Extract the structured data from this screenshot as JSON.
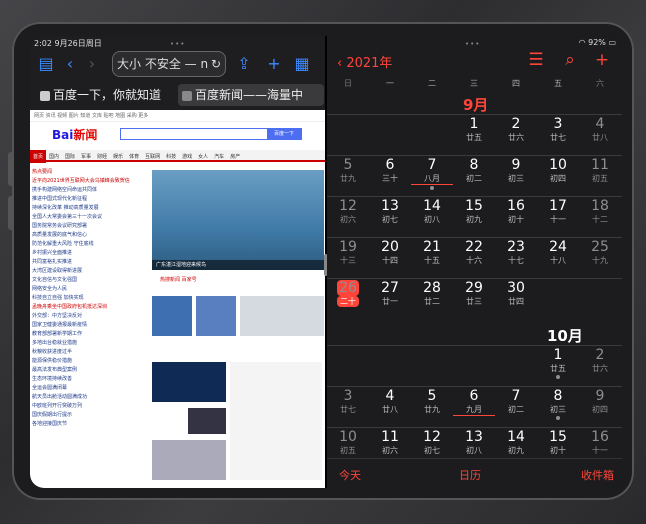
{
  "safari": {
    "status_time": "2:02  9月26日周日",
    "url_text": "大小  不安全 — n",
    "tabs": [
      {
        "label": "百度一下，你就知道"
      },
      {
        "label": "百度新闻——海量中"
      }
    ],
    "page": {
      "top_links": "网页 资讯 视频 图片 知道 文库 贴吧 地图 采购 更多",
      "logo_text": "Bai",
      "logo_suffix": "新闻",
      "search_button": "百度一下",
      "nav_items": [
        "首页",
        "国内",
        "国际",
        "军事",
        "财经",
        "娱乐",
        "体育",
        "互联网",
        "科技",
        "游戏",
        "女人",
        "汽车",
        "房产"
      ],
      "news": [
        "热点要闻",
        "近平向2021世界互联网大会乌镇峰会致贺信",
        "携手构建网络空间命运共同体",
        "推进中国式现代化新征程",
        "持续深化改革 推动高质量发展",
        "全国人大常委会第三十一次会议",
        "国务院常务会议研究部署",
        "高质量发展的底气和信心",
        "防范化解重大风险 守住底线",
        "乡村振兴全面推进",
        "共同富裕扎实推进",
        "大湾区建设取得新进展",
        "文化自信与文化强国",
        "网络安全为人民",
        "科技自立自强 加快实现",
        "孟晚舟乘坐中国政府包机抵达深圳",
        "外交部：中方坚决反对",
        "国家卫健委通报最新疫情",
        "教育部部署新学期工作",
        "多地出台稳就业措施",
        "秋粮收获进度过半",
        "能源保供稳价措施",
        "最高法发布典型案例",
        "生态环境持续改善",
        "全运会圆满闭幕",
        "航天员出舱活动圆满成功",
        "中欧班列开行突破万列",
        "国庆假期出行提示",
        "各地迎接国庆节"
      ],
      "hero_caption": "广东湛江湿地迎来候鸟",
      "section_links": "热搜新闻  百家号"
    }
  },
  "calendar": {
    "status_right": "92%",
    "year_title": "2021年",
    "weekdays": [
      "日",
      "一",
      "二",
      "三",
      "四",
      "五",
      "六"
    ],
    "months": [
      {
        "label": "9月",
        "weeks": [
          [
            null,
            null,
            null,
            {
              "n": "1",
              "l": "廿五"
            },
            {
              "n": "2",
              "l": "廿六"
            },
            {
              "n": "3",
              "l": "廿七"
            },
            {
              "n": "4",
              "l": "廿八"
            }
          ],
          [
            {
              "n": "5",
              "l": "廿九"
            },
            {
              "n": "6",
              "l": "三十"
            },
            {
              "n": "7",
              "l": "八月",
              "hl": true,
              "dot": true
            },
            {
              "n": "8",
              "l": "初二"
            },
            {
              "n": "9",
              "l": "初三"
            },
            {
              "n": "10",
              "l": "初四"
            },
            {
              "n": "11",
              "l": "初五"
            }
          ],
          [
            {
              "n": "12",
              "l": "初六"
            },
            {
              "n": "13",
              "l": "初七"
            },
            {
              "n": "14",
              "l": "初八"
            },
            {
              "n": "15",
              "l": "初九"
            },
            {
              "n": "16",
              "l": "初十"
            },
            {
              "n": "17",
              "l": "十一"
            },
            {
              "n": "18",
              "l": "十二"
            }
          ],
          [
            {
              "n": "19",
              "l": "十三"
            },
            {
              "n": "20",
              "l": "十四"
            },
            {
              "n": "21",
              "l": "十五"
            },
            {
              "n": "22",
              "l": "十六"
            },
            {
              "n": "23",
              "l": "十七"
            },
            {
              "n": "24",
              "l": "十八"
            },
            {
              "n": "25",
              "l": "十九"
            }
          ],
          [
            {
              "n": "26",
              "l": "二十",
              "today": true
            },
            {
              "n": "27",
              "l": "廿一"
            },
            {
              "n": "28",
              "l": "廿二"
            },
            {
              "n": "29",
              "l": "廿三"
            },
            {
              "n": "30",
              "l": "廿四"
            },
            null,
            null
          ]
        ]
      },
      {
        "label": "10月",
        "weeks": [
          [
            null,
            null,
            null,
            null,
            null,
            {
              "n": "1",
              "l": "廿五",
              "dot": true
            },
            {
              "n": "2",
              "l": "廿六"
            }
          ],
          [
            {
              "n": "3",
              "l": "廿七"
            },
            {
              "n": "4",
              "l": "廿八"
            },
            {
              "n": "5",
              "l": "廿九"
            },
            {
              "n": "6",
              "l": "九月",
              "hl": true
            },
            {
              "n": "7",
              "l": "初二"
            },
            {
              "n": "8",
              "l": "初三",
              "dot": true
            },
            {
              "n": "9",
              "l": "初四"
            }
          ],
          [
            {
              "n": "10",
              "l": "初五"
            },
            {
              "n": "11",
              "l": "初六"
            },
            {
              "n": "12",
              "l": "初七"
            },
            {
              "n": "13",
              "l": "初八"
            },
            {
              "n": "14",
              "l": "初九"
            },
            {
              "n": "15",
              "l": "初十"
            },
            {
              "n": "16",
              "l": "十一"
            }
          ]
        ]
      }
    ],
    "bottom": {
      "today": "今天",
      "calendars": "日历",
      "inbox": "收件箱"
    }
  }
}
